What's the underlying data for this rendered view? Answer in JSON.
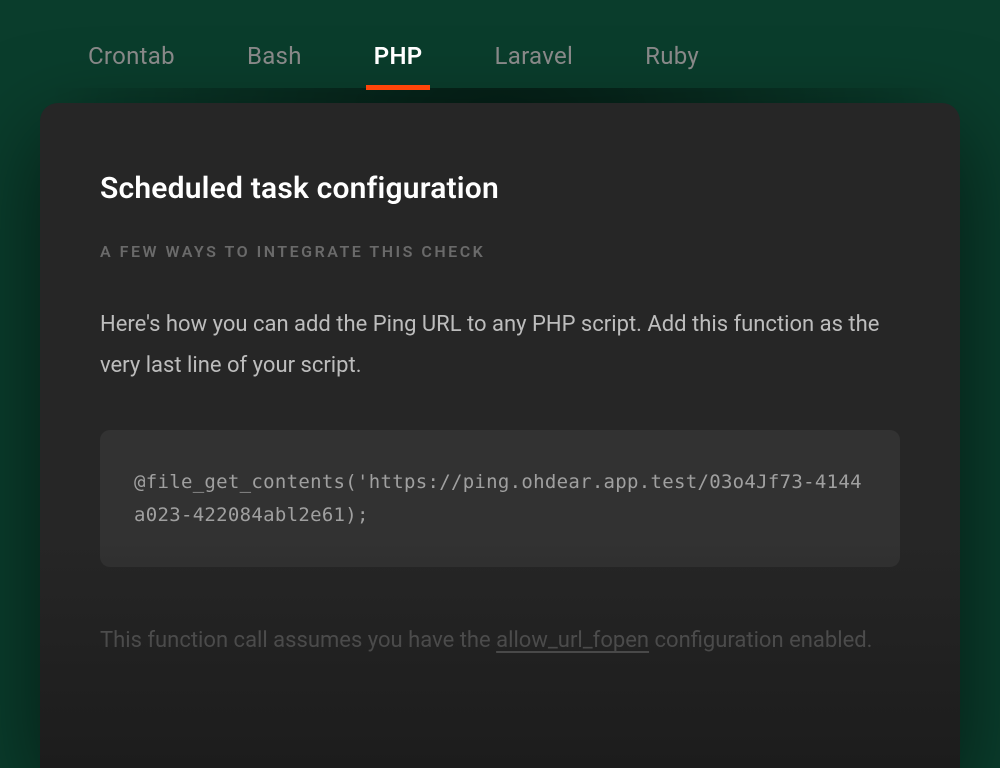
{
  "tabs": [
    {
      "label": "Crontab",
      "active": false
    },
    {
      "label": "Bash",
      "active": false
    },
    {
      "label": "PHP",
      "active": true
    },
    {
      "label": "Laravel",
      "active": false
    },
    {
      "label": "Ruby",
      "active": false
    }
  ],
  "panel": {
    "title": "Scheduled task configuration",
    "subtitle": "A few ways to integrate this check",
    "body": "Here's how you can add the Ping URL to any PHP script. Add this function as the very last line of your script.",
    "code": "@file_get_contents('https://ping.ohdear.app.test/03o4Jf73-4144a023-422084abl2e61);",
    "footer_pre": "This function call assumes you have the ",
    "footer_link": "allow_url_fopen",
    "footer_post": " configuration enabled."
  }
}
